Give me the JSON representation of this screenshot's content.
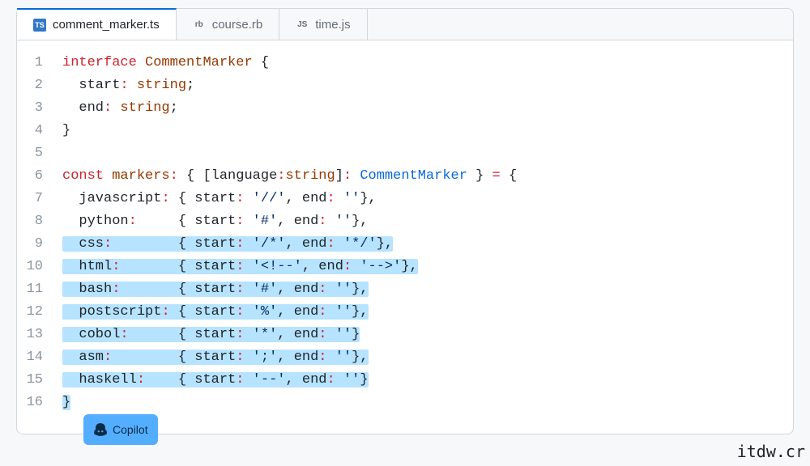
{
  "tabs": [
    {
      "icon": "TS",
      "label": "comment_marker.ts",
      "active": true
    },
    {
      "icon": "rb",
      "label": "course.rb",
      "active": false
    },
    {
      "icon": "JS",
      "label": "time.js",
      "active": false
    }
  ],
  "code": {
    "lines": [
      {
        "n": 1,
        "hl": false,
        "tokens": [
          [
            "kw",
            "interface"
          ],
          [
            "pn",
            " "
          ],
          [
            "id",
            "CommentMarker"
          ],
          [
            "pn",
            " {"
          ]
        ]
      },
      {
        "n": 2,
        "hl": false,
        "tokens": [
          [
            "pn",
            "  "
          ],
          [
            "prop",
            "start"
          ],
          [
            "op",
            ": "
          ],
          [
            "id",
            "string"
          ],
          [
            "pn",
            ";"
          ]
        ]
      },
      {
        "n": 3,
        "hl": false,
        "tokens": [
          [
            "pn",
            "  "
          ],
          [
            "prop",
            "end"
          ],
          [
            "op",
            ": "
          ],
          [
            "id",
            "string"
          ],
          [
            "pn",
            ";"
          ]
        ]
      },
      {
        "n": 4,
        "hl": false,
        "tokens": [
          [
            "pn",
            "}"
          ]
        ]
      },
      {
        "n": 5,
        "hl": false,
        "tokens": [
          [
            "pn",
            ""
          ]
        ]
      },
      {
        "n": 6,
        "hl": false,
        "tokens": [
          [
            "kw",
            "const"
          ],
          [
            "pn",
            " "
          ],
          [
            "id",
            "markers"
          ],
          [
            "op",
            ": "
          ],
          [
            "pn",
            "{ ["
          ],
          [
            "prop",
            "language"
          ],
          [
            "op",
            ":"
          ],
          [
            "id",
            "string"
          ],
          [
            "pn",
            "]"
          ],
          [
            "op",
            ": "
          ],
          [
            "tp",
            "CommentMarker"
          ],
          [
            "pn",
            " } "
          ],
          [
            "op",
            "="
          ],
          [
            "pn",
            " {"
          ]
        ]
      },
      {
        "n": 7,
        "hl": false,
        "tokens": [
          [
            "pn",
            "  "
          ],
          [
            "prop",
            "javascript"
          ],
          [
            "op",
            ":"
          ],
          [
            "pn",
            " { "
          ],
          [
            "prop",
            "start"
          ],
          [
            "op",
            ": "
          ],
          [
            "str",
            "'//'"
          ],
          [
            "pn",
            ", "
          ],
          [
            "prop",
            "end"
          ],
          [
            "op",
            ": "
          ],
          [
            "str",
            "''"
          ],
          [
            "pn",
            "},"
          ]
        ]
      },
      {
        "n": 8,
        "hl": false,
        "tokens": [
          [
            "pn",
            "  "
          ],
          [
            "prop",
            "python"
          ],
          [
            "op",
            ":"
          ],
          [
            "pn",
            "     { "
          ],
          [
            "prop",
            "start"
          ],
          [
            "op",
            ": "
          ],
          [
            "str",
            "'#'"
          ],
          [
            "pn",
            ", "
          ],
          [
            "prop",
            "end"
          ],
          [
            "op",
            ": "
          ],
          [
            "str",
            "''"
          ],
          [
            "pn",
            "},"
          ]
        ]
      },
      {
        "n": 9,
        "hl": true,
        "tokens": [
          [
            "pn",
            "  "
          ],
          [
            "prop",
            "css"
          ],
          [
            "op",
            ":"
          ],
          [
            "pn",
            "        { "
          ],
          [
            "prop",
            "start"
          ],
          [
            "op",
            ": "
          ],
          [
            "str",
            "'/*'"
          ],
          [
            "pn",
            ", "
          ],
          [
            "prop",
            "end"
          ],
          [
            "op",
            ": "
          ],
          [
            "str",
            "'*/'"
          ],
          [
            "pn",
            "},"
          ]
        ]
      },
      {
        "n": 10,
        "hl": true,
        "tokens": [
          [
            "pn",
            "  "
          ],
          [
            "prop",
            "html"
          ],
          [
            "op",
            ":"
          ],
          [
            "pn",
            "       { "
          ],
          [
            "prop",
            "start"
          ],
          [
            "op",
            ": "
          ],
          [
            "str",
            "'<!--'"
          ],
          [
            "pn",
            ", "
          ],
          [
            "prop",
            "end"
          ],
          [
            "op",
            ": "
          ],
          [
            "str",
            "'-->'"
          ],
          [
            "pn",
            "},"
          ]
        ]
      },
      {
        "n": 11,
        "hl": true,
        "tokens": [
          [
            "pn",
            "  "
          ],
          [
            "prop",
            "bash"
          ],
          [
            "op",
            ":"
          ],
          [
            "pn",
            "       { "
          ],
          [
            "prop",
            "start"
          ],
          [
            "op",
            ": "
          ],
          [
            "str",
            "'#'"
          ],
          [
            "pn",
            ", "
          ],
          [
            "prop",
            "end"
          ],
          [
            "op",
            ": "
          ],
          [
            "str",
            "''"
          ],
          [
            "pn",
            "},"
          ]
        ]
      },
      {
        "n": 12,
        "hl": true,
        "tokens": [
          [
            "pn",
            "  "
          ],
          [
            "prop",
            "postscript"
          ],
          [
            "op",
            ":"
          ],
          [
            "pn",
            " { "
          ],
          [
            "prop",
            "start"
          ],
          [
            "op",
            ": "
          ],
          [
            "str",
            "'%'"
          ],
          [
            "pn",
            ", "
          ],
          [
            "prop",
            "end"
          ],
          [
            "op",
            ": "
          ],
          [
            "str",
            "''"
          ],
          [
            "pn",
            "},"
          ]
        ]
      },
      {
        "n": 13,
        "hl": true,
        "tokens": [
          [
            "pn",
            "  "
          ],
          [
            "prop",
            "cobol"
          ],
          [
            "op",
            ":"
          ],
          [
            "pn",
            "      { "
          ],
          [
            "prop",
            "start"
          ],
          [
            "op",
            ": "
          ],
          [
            "str",
            "'*'"
          ],
          [
            "pn",
            ", "
          ],
          [
            "prop",
            "end"
          ],
          [
            "op",
            ": "
          ],
          [
            "str",
            "''"
          ],
          [
            "pn",
            "}"
          ]
        ]
      },
      {
        "n": 14,
        "hl": true,
        "tokens": [
          [
            "pn",
            "  "
          ],
          [
            "prop",
            "asm"
          ],
          [
            "op",
            ":"
          ],
          [
            "pn",
            "        { "
          ],
          [
            "prop",
            "start"
          ],
          [
            "op",
            ": "
          ],
          [
            "str",
            "';'"
          ],
          [
            "pn",
            ", "
          ],
          [
            "prop",
            "end"
          ],
          [
            "op",
            ": "
          ],
          [
            "str",
            "''"
          ],
          [
            "pn",
            "},"
          ]
        ]
      },
      {
        "n": 15,
        "hl": true,
        "tokens": [
          [
            "pn",
            "  "
          ],
          [
            "prop",
            "haskell"
          ],
          [
            "op",
            ":"
          ],
          [
            "pn",
            "    { "
          ],
          [
            "prop",
            "start"
          ],
          [
            "op",
            ": "
          ],
          [
            "str",
            "'--'"
          ],
          [
            "pn",
            ", "
          ],
          [
            "prop",
            "end"
          ],
          [
            "op",
            ": "
          ],
          [
            "str",
            "''"
          ],
          [
            "pn",
            "}"
          ]
        ]
      },
      {
        "n": 16,
        "hl": true,
        "tokens": [
          [
            "pn",
            "}"
          ]
        ]
      }
    ]
  },
  "copilot": {
    "label": "Copilot"
  },
  "watermark": "itdw.cr"
}
